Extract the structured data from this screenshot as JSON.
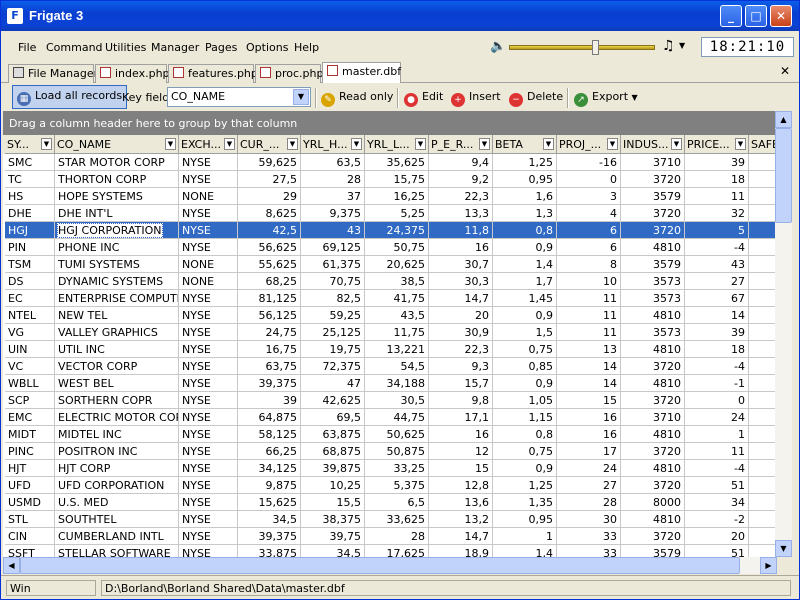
{
  "window": {
    "title": "Frigate 3",
    "minimize": "_",
    "maximize": "□",
    "close": "✕"
  },
  "menus": [
    "File",
    "Command",
    "Utilities",
    "Manager",
    "Pages",
    "Options",
    "Help"
  ],
  "player": {
    "speaker_icon": "speaker-icon",
    "volume_level": 0.57,
    "music_icon": "music-note-icon",
    "clock": "18:21:10"
  },
  "tabs": [
    {
      "label": "File Manager",
      "icon": "file-manager-icon"
    },
    {
      "label": "index.php",
      "icon": "file-icon"
    },
    {
      "label": "features.php",
      "icon": "file-icon"
    },
    {
      "label": "proc.php",
      "icon": "file-icon"
    },
    {
      "label": "master.dbf",
      "icon": "file-icon",
      "active": true
    }
  ],
  "toolbar": {
    "load_label": "Load all records",
    "keyfield_label": "Key field:",
    "keyfield_value": "CO_NAME",
    "readonly_label": "Read only",
    "edit_label": "Edit",
    "insert_label": "Insert",
    "delete_label": "Delete",
    "export_label": "Export"
  },
  "grid": {
    "group_hint": "Drag a column header here to group by that column",
    "columns": [
      "SY...",
      "CO_NAME",
      "EXCH...",
      "CUR_...",
      "YRL_H...",
      "YRL_L...",
      "P_E_R...",
      "BETA",
      "PROJ_...",
      "INDUS...",
      "PRICE...",
      "SAFE"
    ],
    "selected_row": 4,
    "rows": [
      [
        "SMC",
        "STAR MOTOR CORP",
        "NYSE",
        "59,625",
        "63,5",
        "35,625",
        "9,4",
        "1,25",
        "-16",
        "3710",
        "39",
        ""
      ],
      [
        "TC",
        "THORTON CORP",
        "NYSE",
        "27,5",
        "28",
        "15,75",
        "9,2",
        "0,95",
        "0",
        "3720",
        "18",
        ""
      ],
      [
        "HS",
        "HOPE SYSTEMS",
        "NONE",
        "29",
        "37",
        "16,25",
        "22,3",
        "1,6",
        "3",
        "3579",
        "11",
        ""
      ],
      [
        "DHE",
        "DHE INT'L",
        "NYSE",
        "8,625",
        "9,375",
        "5,25",
        "13,3",
        "1,3",
        "4",
        "3720",
        "32",
        ""
      ],
      [
        "HGJ",
        "HGJ CORPORATION",
        "NYSE",
        "42,5",
        "43",
        "24,375",
        "11,8",
        "0,8",
        "6",
        "3720",
        "5",
        ""
      ],
      [
        "PIN",
        "PHONE INC",
        "NYSE",
        "56,625",
        "69,125",
        "50,75",
        "16",
        "0,9",
        "6",
        "4810",
        "-4",
        ""
      ],
      [
        "TSM",
        "TUMI SYSTEMS",
        "NONE",
        "55,625",
        "61,375",
        "20,625",
        "30,7",
        "1,4",
        "8",
        "3579",
        "43",
        ""
      ],
      [
        "DS",
        "DYNAMIC SYSTEMS",
        "NONE",
        "68,25",
        "70,75",
        "38,5",
        "30,3",
        "1,7",
        "10",
        "3573",
        "27",
        ""
      ],
      [
        "EC",
        "ENTERPRISE COMPUTER",
        "NYSE",
        "81,125",
        "82,5",
        "41,75",
        "14,7",
        "1,45",
        "11",
        "3573",
        "67",
        ""
      ],
      [
        "NTEL",
        "NEW TEL",
        "NYSE",
        "56,125",
        "59,25",
        "43,5",
        "20",
        "0,9",
        "11",
        "4810",
        "14",
        ""
      ],
      [
        "VG",
        "VALLEY GRAPHICS",
        "NYSE",
        "24,75",
        "25,125",
        "11,75",
        "30,9",
        "1,5",
        "11",
        "3573",
        "39",
        ""
      ],
      [
        "UIN",
        "UTIL INC",
        "NYSE",
        "16,75",
        "19,75",
        "13,221",
        "22,3",
        "0,75",
        "13",
        "4810",
        "18",
        ""
      ],
      [
        "VC",
        "VECTOR CORP",
        "NYSE",
        "63,75",
        "72,375",
        "54,5",
        "9,3",
        "0,85",
        "14",
        "3720",
        "-4",
        ""
      ],
      [
        "WBLL",
        "WEST BEL",
        "NYSE",
        "39,375",
        "47",
        "34,188",
        "15,7",
        "0,9",
        "14",
        "4810",
        "-1",
        ""
      ],
      [
        "SCP",
        "SORTHERN COPR",
        "NYSE",
        "39",
        "42,625",
        "30,5",
        "9,8",
        "1,05",
        "15",
        "3720",
        "0",
        ""
      ],
      [
        "EMC",
        "ELECTRIC MOTOR CORP",
        "NYSE",
        "64,875",
        "69,5",
        "44,75",
        "17,1",
        "1,15",
        "16",
        "3710",
        "24",
        ""
      ],
      [
        "MIDT",
        "MIDTEL INC",
        "NYSE",
        "58,125",
        "63,875",
        "50,625",
        "16",
        "0,8",
        "16",
        "4810",
        "1",
        ""
      ],
      [
        "PINC",
        "POSITRON INC",
        "NYSE",
        "66,25",
        "68,875",
        "50,875",
        "12",
        "0,75",
        "17",
        "3720",
        "11",
        ""
      ],
      [
        "HJT",
        "HJT CORP",
        "NYSE",
        "34,125",
        "39,875",
        "33,25",
        "15",
        "0,9",
        "24",
        "4810",
        "-4",
        ""
      ],
      [
        "UFD",
        "UFD CORPORATION",
        "NYSE",
        "9,875",
        "10,25",
        "5,375",
        "12,8",
        "1,25",
        "27",
        "3720",
        "51",
        ""
      ],
      [
        "USMD",
        "U.S. MED",
        "NYSE",
        "15,625",
        "15,5",
        "6,5",
        "13,6",
        "1,35",
        "28",
        "8000",
        "34",
        ""
      ],
      [
        "STL",
        "SOUTHTEL",
        "NYSE",
        "34,5",
        "38,375",
        "33,625",
        "13,2",
        "0,95",
        "30",
        "4810",
        "-2",
        ""
      ],
      [
        "CIN",
        "CUMBERLAND INTL",
        "NYSE",
        "39,375",
        "39,75",
        "28",
        "14,7",
        "1",
        "33",
        "3720",
        "20",
        ""
      ],
      [
        "SSFT",
        "STELLAR SOFTWARE",
        "NYSE",
        "33,875",
        "34,5",
        "17,625",
        "18,9",
        "1,4",
        "33",
        "3579",
        "51",
        ""
      ]
    ]
  },
  "status": {
    "mode": "Win",
    "path": "D:\\Borland\\Borland Shared\\Data\\master.dbf"
  }
}
